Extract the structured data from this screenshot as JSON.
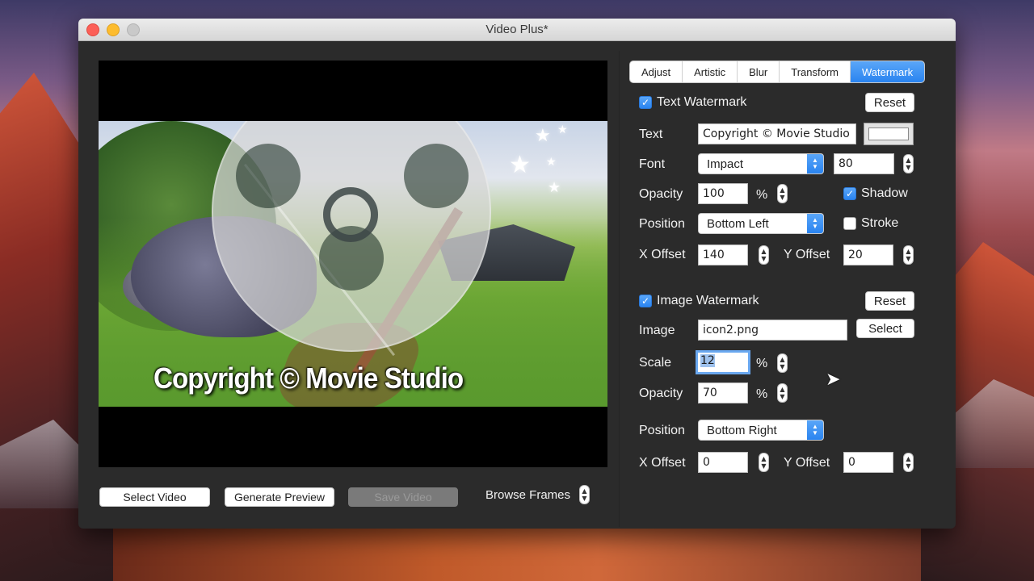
{
  "window": {
    "title": "Video Plus*"
  },
  "preview": {
    "watermark_text": "Copyright © Movie Studio"
  },
  "bottom_bar": {
    "select_video": "Select Video",
    "generate_preview": "Generate Preview",
    "save_video": "Save Video",
    "browse_frames": "Browse Frames"
  },
  "tabs": [
    {
      "label": "Adjust"
    },
    {
      "label": "Artistic"
    },
    {
      "label": "Blur"
    },
    {
      "label": "Transform"
    },
    {
      "label": "Watermark",
      "active": true
    }
  ],
  "text_watermark": {
    "enabled": true,
    "title": "Text Watermark",
    "reset_label": "Reset",
    "text_label": "Text",
    "text_value": "Copyright © Movie Studio",
    "text_color": "#ffffff",
    "font_label": "Font",
    "font_value": "Impact",
    "font_size": "80",
    "opacity_label": "Opacity",
    "opacity_value": "100",
    "percent": "%",
    "shadow_label": "Shadow",
    "shadow_checked": true,
    "position_label": "Position",
    "position_value": "Bottom Left",
    "stroke_label": "Stroke",
    "stroke_checked": false,
    "x_offset_label": "X Offset",
    "x_offset_value": "140",
    "y_offset_label": "Y Offset",
    "y_offset_value": "20"
  },
  "image_watermark": {
    "enabled": true,
    "title": "Image Watermark",
    "reset_label": "Reset",
    "image_label": "Image",
    "image_value": "icon2.png",
    "select_label": "Select",
    "scale_label": "Scale",
    "scale_value": "12",
    "percent": "%",
    "opacity_label": "Opacity",
    "opacity_value": "70",
    "position_label": "Position",
    "position_value": "Bottom Right",
    "x_offset_label": "X Offset",
    "x_offset_value": "0",
    "y_offset_label": "Y Offset",
    "y_offset_value": "0"
  },
  "colors": {
    "accent": "#2a84f0",
    "window_bg": "#2b2b2b"
  }
}
